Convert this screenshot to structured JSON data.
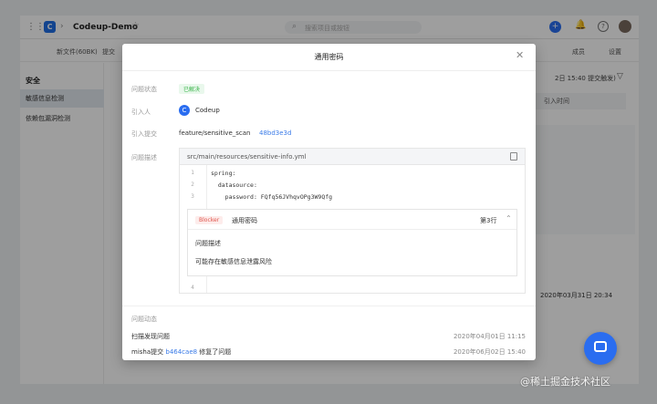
{
  "app": {
    "project_name": "Codeup-Demo",
    "logo_letter": "C",
    "search_placeholder": "搜索项目或按钮",
    "sub_tabs": [
      "新文件(60BK)",
      "提交"
    ],
    "sub_right": [
      "成员",
      "设置"
    ]
  },
  "sidebar": {
    "heading": "安全",
    "items": [
      {
        "label": "敏感信息检测",
        "active": true
      },
      {
        "label": "依赖包漏洞检测",
        "active": false
      }
    ]
  },
  "background": {
    "time_text": "2日 15:40 提交触发)",
    "column_header": "引入时间",
    "date_text": "2020年03月31日 20:34"
  },
  "modal": {
    "title": "通用密码",
    "fields": {
      "status_label": "问题状态",
      "status_value": "已解决",
      "introducer_label": "引入人",
      "introducer_value": "Codeup",
      "commit_label": "引入提交",
      "commit_branch": "feature/sensitive_scan",
      "commit_hash": "48bd3e3d",
      "desc_label": "问题描述"
    },
    "file": {
      "path": "src/main/resources/sensitive-info.yml",
      "lines": [
        {
          "no": "1",
          "text": "spring:"
        },
        {
          "no": "2",
          "text": "  datasource:"
        },
        {
          "no": "3",
          "text": "    password: FQfq56JVhqvOPg3W9Qfg"
        },
        {
          "no": "4",
          "text": ""
        }
      ]
    },
    "issue": {
      "severity": "Blocker",
      "name": "通用密码",
      "line": "第3行",
      "desc_label": "问题描述",
      "desc": "可能存在敏感信息泄露风险"
    },
    "activity": {
      "label": "问题动态",
      "items": [
        {
          "text": "扫描发现问题",
          "link": "",
          "suffix": "",
          "time": "2020年04月01日 11:15"
        },
        {
          "text": "misha提交 ",
          "link": "b464cae8",
          "suffix": " 修复了问题",
          "time": "2020年06月02日 15:40"
        }
      ]
    }
  },
  "watermark": "@稀土掘金技术社区",
  "colors": {
    "accent": "#2a6df0",
    "success": "#3cb44b",
    "blocker": "#e0554c",
    "link": "#3a7be8"
  }
}
